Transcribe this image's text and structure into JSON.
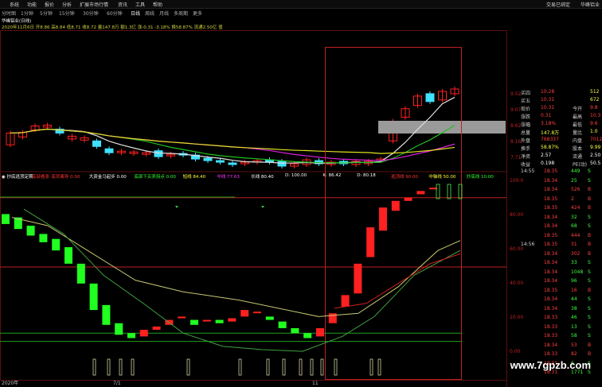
{
  "menu": {
    "items": [
      "系统",
      "功能",
      "报价",
      "分析",
      "扩展市场行情",
      "资讯",
      "工具",
      "帮助"
    ],
    "right": [
      "交易已绑定",
      "华峰铝业"
    ]
  },
  "timeframes": {
    "items": [
      "分时图",
      "1分钟",
      "5分钟",
      "15分钟",
      "30分钟",
      "60分钟",
      "日线",
      "周线",
      "月线",
      "多周期",
      "更多"
    ],
    "active": "日线"
  },
  "upper_info": {
    "title": "华峰铝业(日线)",
    "line2": "2020年11月6日 开8.86 高8.84 低8.71 收8.72 量147.8万 额1.3亿 涨-0.31 -3.18% 换58.87% 流通2.50亿 值"
  },
  "indicator_header": {
    "name": "抄底逃顶定期",
    "items": [
      {
        "label": "底部看涨",
        "color": "#ff3030"
      },
      {
        "label": "底背离导 0.00",
        "color": "#ff3030"
      },
      {
        "label": "大资金马起步 0.00",
        "color": "#ffffff"
      },
      {
        "label": "底部下买卖拐点 0.00",
        "color": "#30ff30"
      },
      {
        "label": "短线 84.40",
        "color": "#ffff30"
      },
      {
        "label": "中线 77.63",
        "color": "#ff30ff"
      },
      {
        "label": "长线 80.40",
        "color": "#ffffff"
      },
      {
        "label": "D: 100.00",
        "color": "#ffffff"
      },
      {
        "label": "K: 86.42",
        "color": "#ffffff"
      },
      {
        "label": "D: 80.18",
        "color": "#ffffff"
      },
      {
        "label": "逃顶线 90.00",
        "color": "#ff3030"
      },
      {
        "label": "中轴线 50.00",
        "color": "#ffff30"
      },
      {
        "label": "抄底线 10.00",
        "color": "#30ff30"
      }
    ]
  },
  "upper_axis": [
    "9.52",
    "9.07",
    "8.62",
    "8.16",
    "7.71"
  ],
  "lower_axis": [
    "100.0",
    "80.00",
    "60.00",
    "40.00",
    "20.00",
    "0.00"
  ],
  "x_labels": [
    "2020年",
    "7/1",
    "11"
  ],
  "colors": {
    "up": "#ff2020",
    "down": "#20ff20",
    "frame": "#c02020",
    "ma_white": "#e0e0e0",
    "ma_yellow": "#e0e020",
    "ma_magenta": "#e020e0",
    "ma_green": "#20c020"
  },
  "quote_panel": {
    "rows": [
      {
        "label": "买四",
        "value": "10.28",
        "extra": "512",
        "vc": "#ff4040"
      },
      {
        "label": "买五",
        "value": "10.31",
        "extra": "672",
        "vc": "#ff4040"
      },
      {
        "label": "现价",
        "value": "10.31",
        "l2": "今开",
        "v2": "9.8",
        "vc": "#ff4040"
      },
      {
        "label": "涨跌",
        "value": "0.31",
        "l2": "最高",
        "v2": "10.3",
        "vc": "#ff4040"
      },
      {
        "label": "涨幅",
        "value": "3.18%",
        "l2": "最低",
        "v2": "9.6",
        "vc": "#ff4040"
      },
      {
        "label": "总量",
        "value": "147.8万",
        "l2": "量比",
        "v2": "1.0",
        "vc": "#ffff40"
      },
      {
        "label": "外盘",
        "value": "768337",
        "l2": "内盘",
        "v2": "701291",
        "vc": "#ff4040"
      },
      {
        "label": "换手",
        "value": "58.87%",
        "l2": "股本",
        "v2": "9.99",
        "vc": "#ffff40"
      },
      {
        "label": "净资",
        "value": "2.57",
        "l2": "流通",
        "v2": "2.50",
        "vc": "#ffffff"
      },
      {
        "label": "收益",
        "value": "0.198",
        "l2": "PE(动)",
        "v2": "50.5",
        "vc": "#ffffff"
      }
    ]
  },
  "trades": {
    "time1": "14:55",
    "time2": "14:56",
    "rows": [
      {
        "p": "18.35",
        "v": "449",
        "s": "S"
      },
      {
        "p": "18.34",
        "v": "25",
        "s": "S"
      },
      {
        "p": "18.34",
        "v": "526",
        "s": "B"
      },
      {
        "p": "18.35",
        "v": "2",
        "s": "B"
      },
      {
        "p": "18.35",
        "v": "424",
        "s": "B"
      },
      {
        "p": "18.34",
        "v": "32",
        "s": "S"
      },
      {
        "p": "18.34",
        "v": "68",
        "s": "S"
      },
      {
        "p": "18.35",
        "v": "444",
        "s": "B"
      },
      {
        "p": "18.35",
        "v": "31",
        "s": "B"
      },
      {
        "p": "18.34",
        "v": "302",
        "s": "B"
      },
      {
        "p": "18.34",
        "v": "33",
        "s": "S"
      },
      {
        "p": "18.34",
        "v": "1048",
        "s": "S"
      },
      {
        "p": "18.34",
        "v": "96",
        "s": "S"
      },
      {
        "p": "18.35",
        "v": "16",
        "s": "B"
      },
      {
        "p": "18.34",
        "v": "44",
        "s": "S"
      },
      {
        "p": "18.34",
        "v": "38",
        "s": "S"
      },
      {
        "p": "18.33",
        "v": "46",
        "s": "S"
      },
      {
        "p": "18.33",
        "v": "13",
        "s": "S"
      },
      {
        "p": "18.33",
        "v": "58",
        "s": "S"
      },
      {
        "p": "18.34",
        "v": "53",
        "s": "B"
      },
      {
        "p": "18.33",
        "v": "82",
        "s": "B"
      },
      {
        "p": "18.31",
        "v": "6",
        "s": "S"
      },
      {
        "p": "18.31",
        "v": "1771",
        "s": "S"
      }
    ]
  },
  "watermark": "www.7gpzb.com",
  "chart_data": [
    {
      "type": "candlestick",
      "title": "华峰铝业(日线)",
      "ylim": [
        7.5,
        9.6
      ],
      "candles": [
        {
          "o": 8.1,
          "c": 8.4
        },
        {
          "o": 8.3,
          "c": 8.42
        },
        {
          "o": 8.48,
          "c": 8.58
        },
        {
          "o": 8.55,
          "c": 8.6
        },
        {
          "o": 8.5,
          "c": 8.4
        },
        {
          "o": 8.25,
          "c": 8.32
        },
        {
          "o": 8.22,
          "c": 8.28
        },
        {
          "o": 8.2,
          "c": 8.06
        },
        {
          "o": 8.0,
          "c": 7.9
        },
        {
          "o": 7.9,
          "c": 7.94
        },
        {
          "o": 7.88,
          "c": 7.92
        },
        {
          "o": 7.86,
          "c": 7.9
        },
        {
          "o": 7.95,
          "c": 7.8
        },
        {
          "o": 7.82,
          "c": 7.86
        },
        {
          "o": 7.88,
          "c": 7.84
        },
        {
          "o": 7.84,
          "c": 7.74
        },
        {
          "o": 7.76,
          "c": 7.7
        },
        {
          "o": 7.7,
          "c": 7.66
        },
        {
          "o": 7.64,
          "c": 7.6
        },
        {
          "o": 7.62,
          "c": 7.66
        },
        {
          "o": 7.66,
          "c": 7.7
        },
        {
          "o": 7.72,
          "c": 7.66
        },
        {
          "o": 7.68,
          "c": 7.56
        },
        {
          "o": 7.56,
          "c": 7.62
        },
        {
          "o": 7.6,
          "c": 7.72
        },
        {
          "o": 7.7,
          "c": 7.62
        },
        {
          "o": 7.6,
          "c": 7.66
        },
        {
          "o": 7.68,
          "c": 7.62
        },
        {
          "o": 7.6,
          "c": 7.68
        },
        {
          "o": 7.62,
          "c": 7.68
        },
        {
          "o": 7.7,
          "c": 7.74
        },
        {
          "o": 8.2,
          "c": 8.7
        },
        {
          "o": 8.8,
          "c": 9.02
        },
        {
          "o": 9.1,
          "c": 9.34
        },
        {
          "o": 9.4,
          "c": 9.2
        },
        {
          "o": 9.24,
          "c": 9.46
        },
        {
          "o": 9.4,
          "c": 9.52
        }
      ]
    },
    {
      "type": "candlestick",
      "title": "抄底逃顶定期",
      "ylim": [
        0,
        100
      ],
      "candles": [
        {
          "o": 82,
          "c": 76
        },
        {
          "o": 80,
          "c": 73
        },
        {
          "o": 75,
          "c": 69
        },
        {
          "o": 70,
          "c": 65
        },
        {
          "o": 67,
          "c": 60
        },
        {
          "o": 62,
          "c": 52
        },
        {
          "o": 52,
          "c": 40
        },
        {
          "o": 40,
          "c": 24
        },
        {
          "o": 27,
          "c": 15
        },
        {
          "o": 16,
          "c": 9
        },
        {
          "o": 10,
          "c": 7
        },
        {
          "o": 8,
          "c": 12
        },
        {
          "o": 12,
          "c": 14
        },
        {
          "o": 15,
          "c": 18
        },
        {
          "o": 19,
          "c": 20
        },
        {
          "o": 18,
          "c": 15
        },
        {
          "o": 18,
          "c": 18
        },
        {
          "o": 18,
          "c": 16
        },
        {
          "o": 17,
          "c": 19
        },
        {
          "o": 20,
          "c": 24
        },
        {
          "o": 23,
          "c": 23
        },
        {
          "o": 20,
          "c": 18
        },
        {
          "o": 17,
          "c": 13
        },
        {
          "o": 13,
          "c": 10
        },
        {
          "o": 10,
          "c": 7
        },
        {
          "o": 8,
          "c": 13
        },
        {
          "o": 16,
          "c": 22
        },
        {
          "o": 26,
          "c": 33
        },
        {
          "o": 34,
          "c": 52
        },
        {
          "o": 56,
          "c": 74
        },
        {
          "o": 72,
          "c": 86
        },
        {
          "o": 84,
          "c": 90
        },
        {
          "o": 90,
          "c": 92
        },
        {
          "o": 94,
          "c": 96
        },
        {
          "o": 97,
          "c": 98
        }
      ],
      "ref_lines": [
        90,
        50,
        10
      ]
    }
  ]
}
